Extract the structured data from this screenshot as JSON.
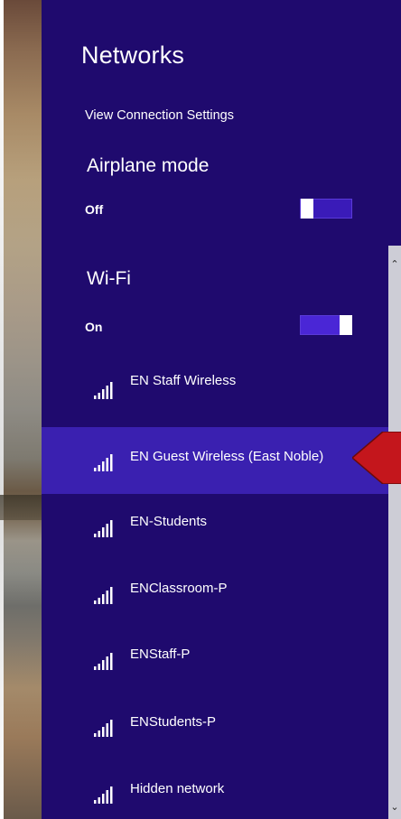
{
  "panel": {
    "title": "Networks",
    "view_connection_settings": "View Connection Settings",
    "accent_color": "#1f0a6e",
    "selected_color": "#3a20b0"
  },
  "airplane_mode": {
    "label": "Airplane mode",
    "state": "Off",
    "on": false
  },
  "wifi": {
    "label": "Wi-Fi",
    "state": "On",
    "on": true
  },
  "networks": [
    {
      "name": "EN Staff Wireless",
      "signal_bars": 5,
      "selected": false
    },
    {
      "name": "EN Guest Wireless (East Noble)",
      "signal_bars": 5,
      "selected": true
    },
    {
      "name": "EN-Students",
      "signal_bars": 5,
      "selected": false
    },
    {
      "name": "ENClassroom-P",
      "signal_bars": 5,
      "selected": false
    },
    {
      "name": "ENStaff-P",
      "signal_bars": 5,
      "selected": false
    },
    {
      "name": "ENStudents-P",
      "signal_bars": 5,
      "selected": false
    },
    {
      "name": "Hidden network",
      "signal_bars": 5,
      "selected": false
    }
  ],
  "icons": {
    "signal": "wifi-signal-icon",
    "scroll_up": "chevron-up-icon",
    "scroll_down": "chevron-down-icon",
    "pointer": "red-arrow-pointer"
  }
}
